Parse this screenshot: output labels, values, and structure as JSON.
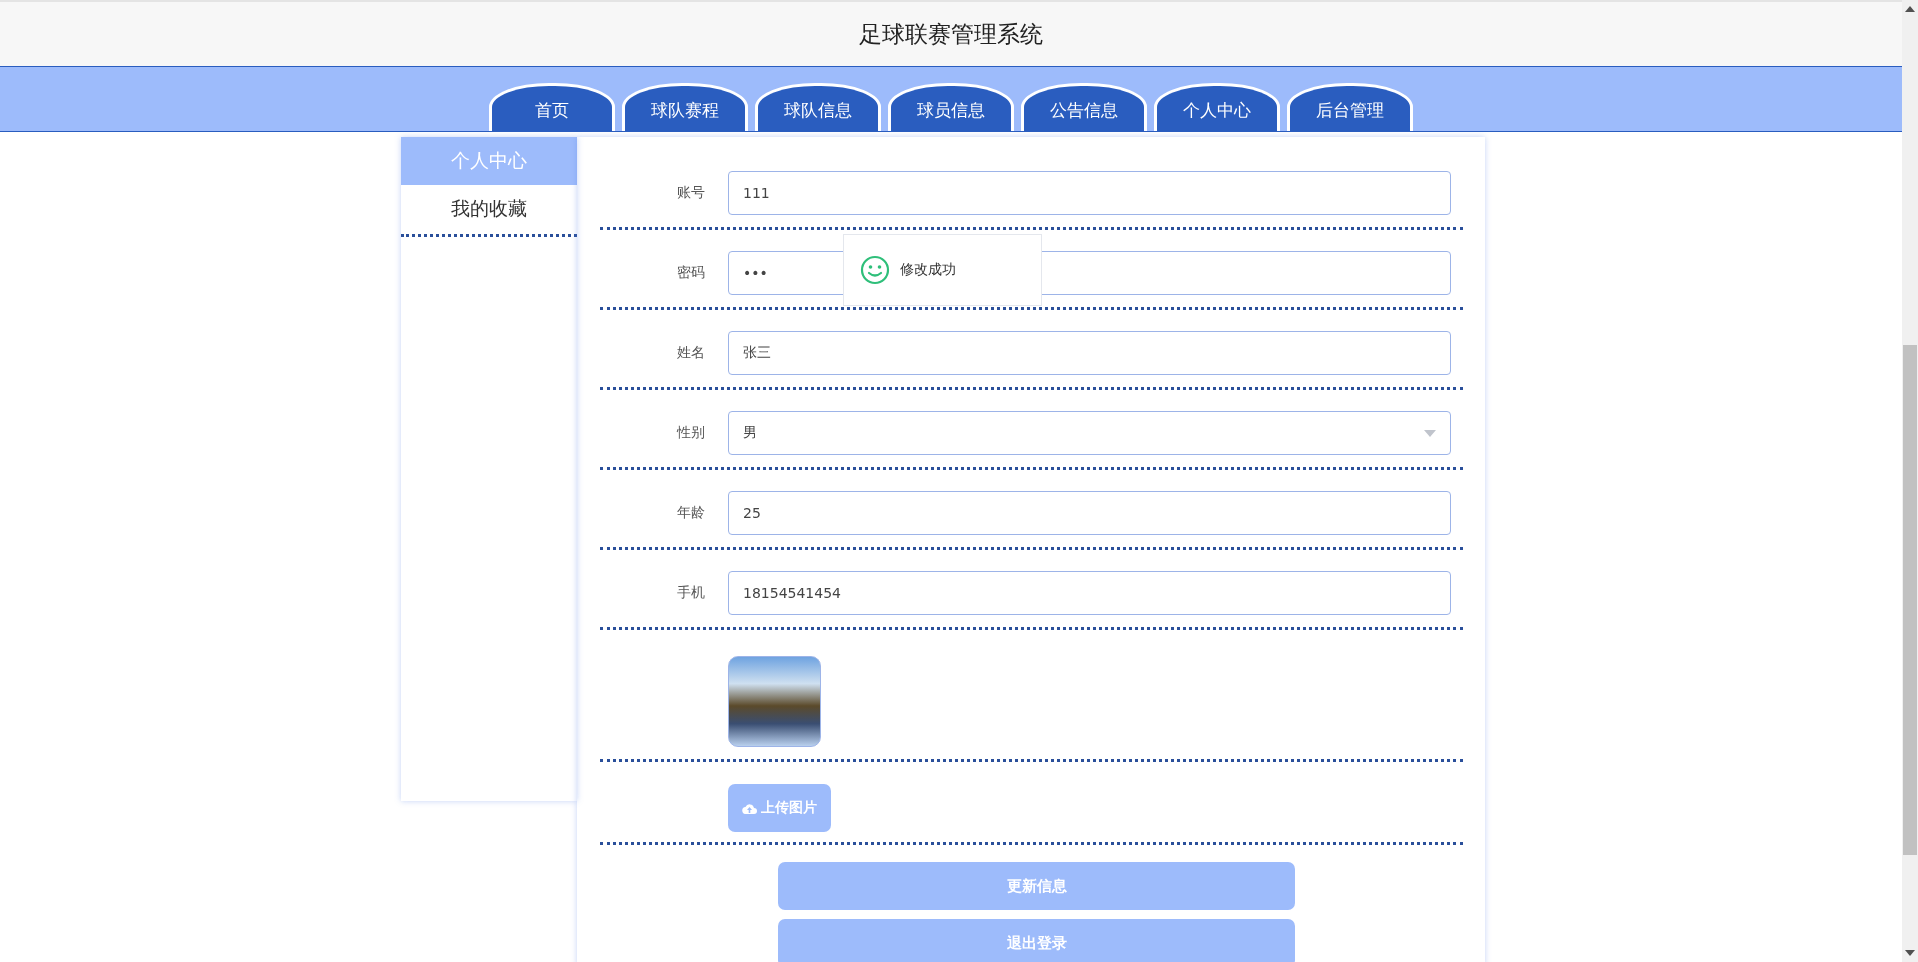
{
  "header": {
    "title": "足球联赛管理系统"
  },
  "nav": {
    "tabs": [
      {
        "label": "首页"
      },
      {
        "label": "球队赛程"
      },
      {
        "label": "球队信息"
      },
      {
        "label": "球员信息"
      },
      {
        "label": "公告信息"
      },
      {
        "label": "个人中心"
      },
      {
        "label": "后台管理"
      }
    ]
  },
  "sidebar": {
    "items": [
      {
        "label": "个人中心",
        "selected": true
      },
      {
        "label": "我的收藏",
        "selected": false
      }
    ]
  },
  "form": {
    "fields": [
      {
        "kind": "input",
        "label": "账号",
        "value": "111"
      },
      {
        "kind": "input",
        "label": "密码",
        "value": "•••"
      },
      {
        "kind": "input",
        "label": "姓名",
        "value": "张三"
      },
      {
        "kind": "select",
        "label": "性别",
        "value": "男"
      },
      {
        "kind": "input",
        "label": "年龄",
        "value": "25"
      },
      {
        "kind": "input",
        "label": "手机",
        "value": "18154541454"
      }
    ],
    "upload_button": "上传图片",
    "buttons": [
      "更新信息",
      "退出登录"
    ]
  },
  "toast": {
    "message": "修改成功"
  }
}
